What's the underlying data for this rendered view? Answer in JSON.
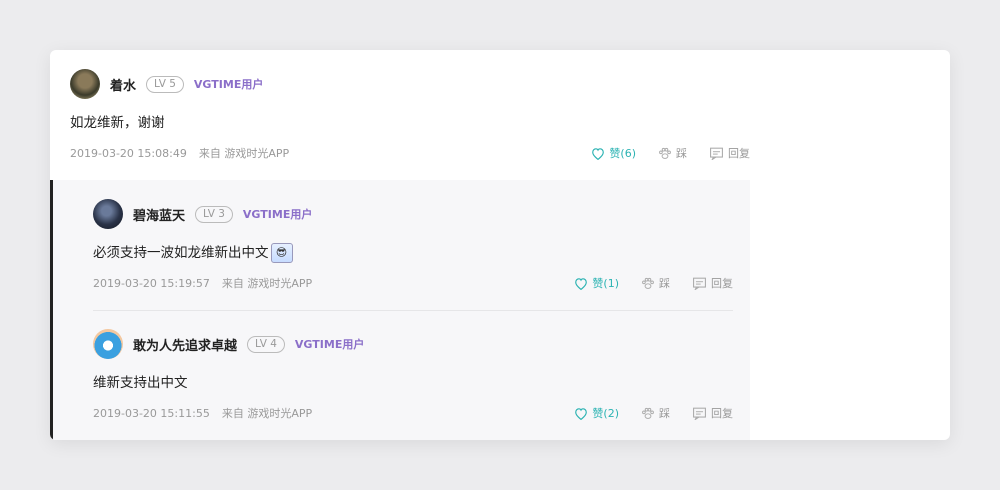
{
  "comments": [
    {
      "username": "着水",
      "level": "LV 5",
      "badge": "VGTIME用户",
      "content": "如龙维新，谢谢",
      "time": "2019-03-20 15:08:49",
      "source": "来自 游戏时光APP",
      "like_label": "赞(6)",
      "dislike_label": "踩",
      "reply_label": "回复"
    }
  ],
  "replies": [
    {
      "username": "碧海蓝天",
      "level": "LV 3",
      "badge": "VGTIME用户",
      "content": "必须支持一波如龙维新出中文",
      "time": "2019-03-20 15:19:57",
      "source": "来自 游戏时光APP",
      "like_label": "赞(1)",
      "dislike_label": "踩",
      "reply_label": "回复"
    },
    {
      "username": "敢为人先追求卓越",
      "level": "LV 4",
      "badge": "VGTIME用户",
      "content": "维新支持出中文",
      "time": "2019-03-20 15:11:55",
      "source": "来自 游戏时光APP",
      "like_label": "赞(2)",
      "dislike_label": "踩",
      "reply_label": "回复"
    }
  ],
  "colors": {
    "accent_like": "#2cb3b3",
    "badge": "#8b6fc9"
  },
  "icons": [
    "heart-icon",
    "paw-icon",
    "reply-icon",
    "emoji-sticker-icon"
  ]
}
